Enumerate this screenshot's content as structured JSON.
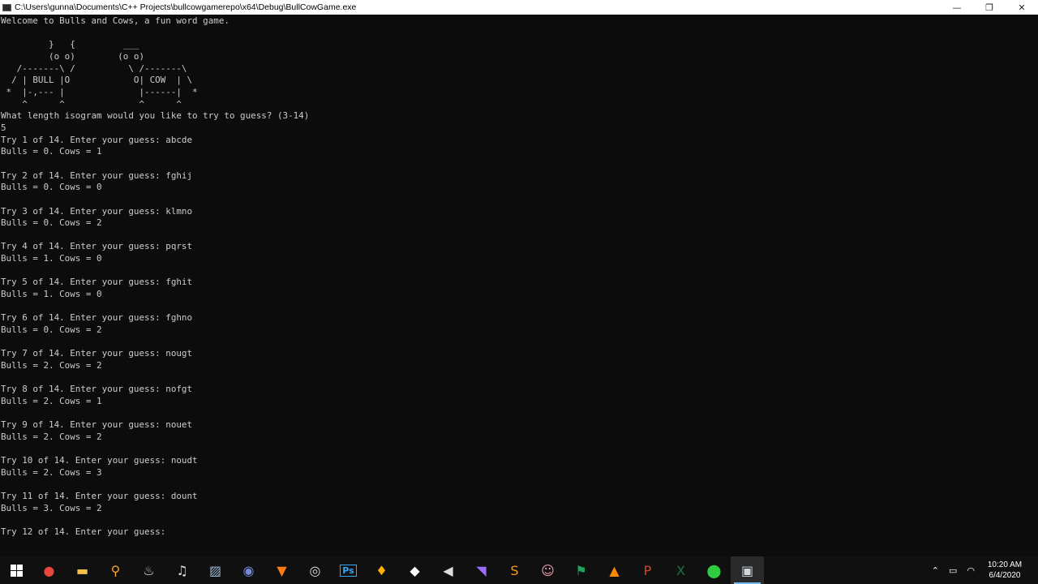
{
  "window": {
    "title": "C:\\Users\\gunna\\Documents\\C++ Projects\\bullcowgamerepo\\x64\\Debug\\BullCowGame.exe",
    "minimize_glyph": "—",
    "restore_glyph": "❐",
    "close_glyph": "✕"
  },
  "console": {
    "text": "Welcome to Bulls and Cows, a fun word game.\n\n         }   {         ___\n         (o o)        (o o)\n   /-------\\ /          \\ /-------\\\n  / | BULL |O            O| COW  | \\\n *  |-,--- |              |------|  *\n    ^      ^              ^      ^\nWhat length isogram would you like to try to guess? (3-14)\n5\nTry 1 of 14. Enter your guess: abcde\nBulls = 0. Cows = 1\n\nTry 2 of 14. Enter your guess: fghij\nBulls = 0. Cows = 0\n\nTry 3 of 14. Enter your guess: klmno\nBulls = 0. Cows = 2\n\nTry 4 of 14. Enter your guess: pqrst\nBulls = 1. Cows = 0\n\nTry 5 of 14. Enter your guess: fghit\nBulls = 1. Cows = 0\n\nTry 6 of 14. Enter your guess: fghno\nBulls = 0. Cows = 2\n\nTry 7 of 14. Enter your guess: nougt\nBulls = 2. Cows = 2\n\nTry 8 of 14. Enter your guess: nofgt\nBulls = 2. Cows = 1\n\nTry 9 of 14. Enter your guess: nouet\nBulls = 2. Cows = 2\n\nTry 10 of 14. Enter your guess: noudt\nBulls = 2. Cows = 3\n\nTry 11 of 14. Enter your guess: dount\nBulls = 3. Cows = 2\n\nTry 12 of 14. Enter your guess: "
  },
  "taskbar": {
    "apps": [
      {
        "name": "chrome-icon",
        "glyph": "●",
        "color": "#e8453c"
      },
      {
        "name": "file-explorer-icon",
        "glyph": "▬",
        "color": "#f3c14b"
      },
      {
        "name": "search-icon",
        "glyph": "⚲",
        "color": "#f5a623"
      },
      {
        "name": "steam-icon",
        "glyph": "♨",
        "color": "#c7d5e0"
      },
      {
        "name": "music-icon",
        "glyph": "♫",
        "color": "#e0e0e0"
      },
      {
        "name": "image-editor-icon",
        "glyph": "▨",
        "color": "#9bb7d4"
      },
      {
        "name": "discord-icon",
        "glyph": "◉",
        "color": "#7289da"
      },
      {
        "name": "triangle-app-icon",
        "glyph": "▼",
        "color": "#ff7b1a"
      },
      {
        "name": "obs-icon",
        "glyph": "◎",
        "color": "#dddddd"
      },
      {
        "name": "photoshop-icon",
        "glyph": "Ps",
        "color": "#31a8ff"
      },
      {
        "name": "bulb-app-icon",
        "glyph": "♦",
        "color": "#ffb300"
      },
      {
        "name": "unity-icon",
        "glyph": "◆",
        "color": "#ffffff"
      },
      {
        "name": "unreal-icon",
        "glyph": "◀",
        "color": "#dddddd"
      },
      {
        "name": "visual-studio-icon",
        "glyph": "◥",
        "color": "#9b6cf5"
      },
      {
        "name": "sublime-text-icon",
        "glyph": "S",
        "color": "#ff9800"
      },
      {
        "name": "character-app-icon",
        "glyph": "☺",
        "color": "#f0a0b0"
      },
      {
        "name": "flag-app-icon",
        "glyph": "⚑",
        "color": "#22a35a"
      },
      {
        "name": "vlc-icon",
        "glyph": "▲",
        "color": "#ff8800"
      },
      {
        "name": "powerpoint-icon",
        "glyph": "P",
        "color": "#d24726"
      },
      {
        "name": "excel-icon",
        "glyph": "X",
        "color": "#1e7145"
      },
      {
        "name": "green-app-icon",
        "glyph": "⬤",
        "color": "#2ecc40"
      },
      {
        "name": "console-app-icon",
        "glyph": "▣",
        "color": "#cfd8dc",
        "active": true
      }
    ],
    "tray": {
      "chevron_glyph": "⌃",
      "battery_glyph": "▭",
      "wifi_glyph": "◠",
      "time": "10:20 AM",
      "date": "6/4/2020"
    }
  }
}
